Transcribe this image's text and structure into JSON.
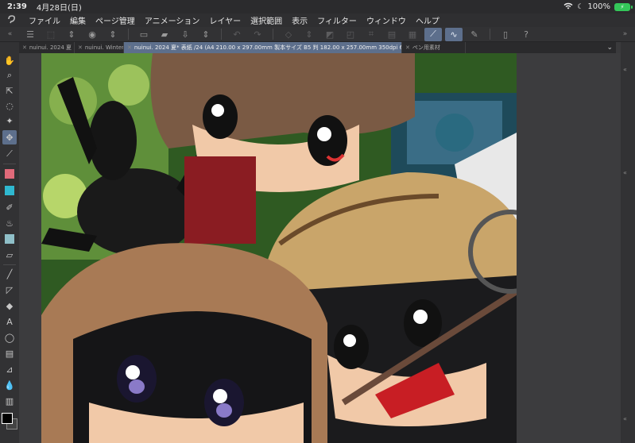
{
  "status_bar": {
    "time": "2:39",
    "date": "4月28日(日)",
    "battery_percent": "100%",
    "battery_color": "#34c759"
  },
  "menu": {
    "items": [
      "ファイル",
      "編集",
      "ページ管理",
      "アニメーション",
      "レイヤー",
      "選択範囲",
      "表示",
      "フィルター",
      "ウィンドウ",
      "ヘルプ"
    ]
  },
  "command_bar": {
    "icons": [
      "menu-icon",
      "new-icon",
      "stepper-icon",
      "camera-icon",
      "stepper-icon",
      "new-page-icon",
      "open-folder-icon",
      "export-icon",
      "stepper-icon",
      "undo-icon",
      "redo-icon",
      "clear-icon",
      "stepper-icon",
      "fill-icon",
      "transform-icon",
      "snap-icon",
      "ruler-icon",
      "grid-icon",
      "pen-active-icon",
      "stroke-active-icon",
      "correction-icon",
      "device-icon",
      "help-icon"
    ],
    "accent": "#5d6f8c"
  },
  "tabs": [
    {
      "label": "nuinui. 2024 夏",
      "active": false
    },
    {
      "label": "nuinui. Winter e",
      "active": false
    },
    {
      "label": "nuinui. 2024 夏* 表紙 /24 (A4 210.00 x 297.00mm 製本サイズ B5 判 182.00 x 257.00mm 350dpi 61.8%)",
      "active": true
    },
    {
      "label": "ペン用素材",
      "active": false
    }
  ],
  "tools": [
    "hand-icon",
    "zoom-icon",
    "select-object-icon",
    "lasso-icon",
    "magic-wand-icon",
    "move-icon",
    "eyedropper-icon",
    "pen-icon",
    "pencil-icon",
    "brush-icon",
    "airbrush-icon",
    "decoration-icon",
    "eraser-icon",
    "line-icon",
    "figure-icon",
    "fill-icon",
    "text-icon",
    "balloon-icon",
    "frame-icon",
    "ruler-icon",
    "blend-icon",
    "gradient-icon"
  ],
  "colors": {
    "foreground": "#000000",
    "background": "#444444"
  }
}
